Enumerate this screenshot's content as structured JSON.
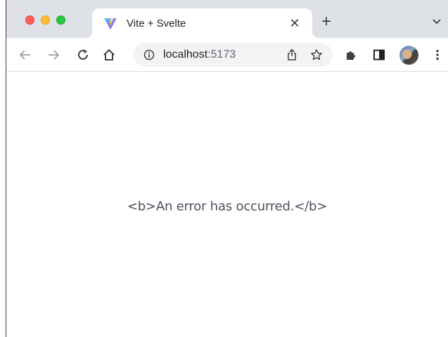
{
  "browser": {
    "tab": {
      "title": "Vite + Svelte",
      "favicon": "vite-logo-icon",
      "close_icon": "close-icon"
    },
    "new_tab_icon": "plus-icon",
    "tab_search_icon": "chevron-down-icon",
    "toolbar": {
      "back_icon": "back-arrow-icon",
      "forward_icon": "forward-arrow-icon",
      "reload_icon": "reload-icon",
      "home_icon": "home-icon",
      "omnibox": {
        "info_icon": "info-icon",
        "host": "localhost",
        "port": ":5173",
        "share_icon": "share-icon",
        "bookmark_icon": "star-icon"
      },
      "extensions_icon": "puzzle-icon",
      "side_panel_icon": "side-panel-icon",
      "profile_icon": "avatar",
      "menu_icon": "kebab-menu-icon"
    }
  },
  "page": {
    "message": "<b>An error has occurred.</b>"
  },
  "colors": {
    "tabstrip": "#dee1e6",
    "omnibox": "#f1f3f4",
    "text": "#202124",
    "message": "#4a4f5c"
  }
}
